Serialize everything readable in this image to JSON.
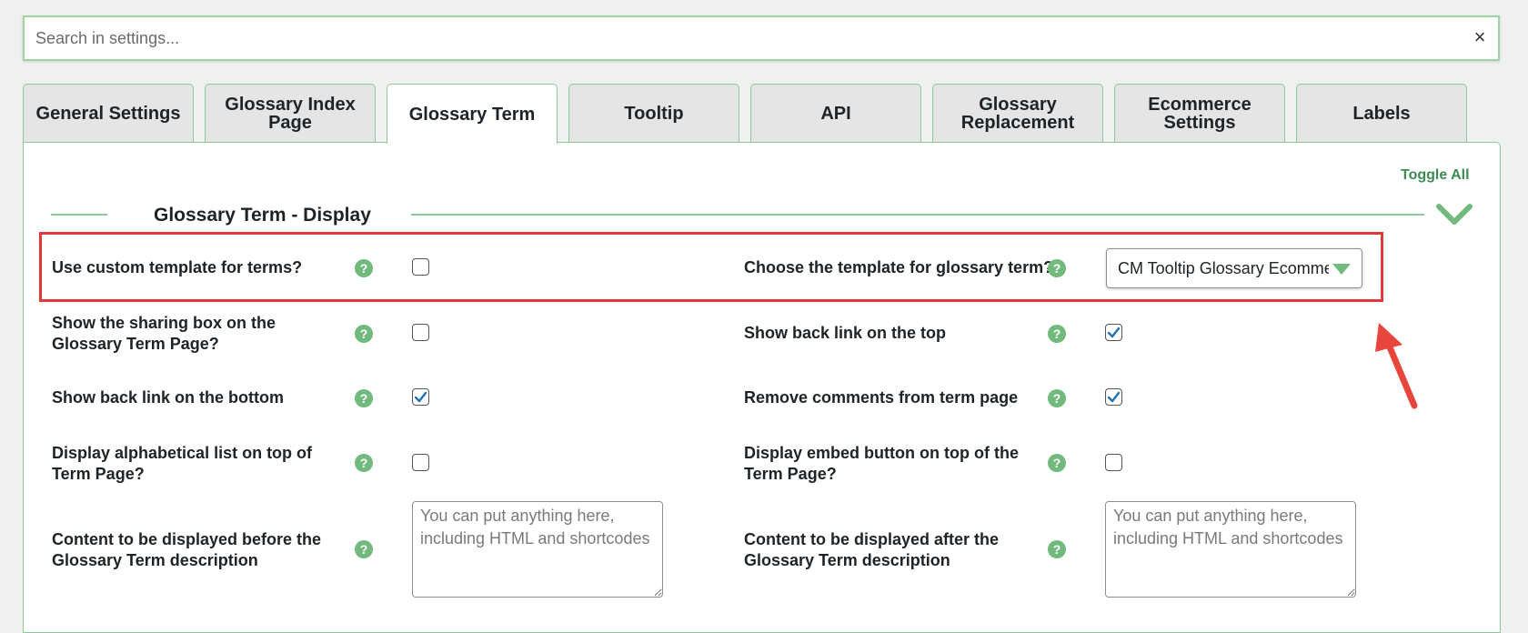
{
  "search": {
    "placeholder": "Search in settings...",
    "clear_glyph": "×"
  },
  "tabs": [
    {
      "label": "General Settings",
      "active": false
    },
    {
      "label": "Glossary Index Page",
      "active": false
    },
    {
      "label": "Glossary Term",
      "active": true
    },
    {
      "label": "Tooltip",
      "active": false
    },
    {
      "label": "API",
      "active": false
    },
    {
      "label": "Glossary Replacement",
      "active": false
    },
    {
      "label": "Ecommerce Settings",
      "active": false
    },
    {
      "label": "Labels",
      "active": false
    }
  ],
  "panel": {
    "toggle_all_label": "Toggle All",
    "section_title": "Glossary Term - Display",
    "section_icon": "chevron-down-icon"
  },
  "settings": {
    "custom_template": {
      "label": "Use custom template for terms?",
      "checked": false
    },
    "sharing_box": {
      "label": "Show the sharing box on the Glossary Term Page?",
      "checked": false
    },
    "back_link_bottom": {
      "label": "Show back link on the bottom",
      "checked": true
    },
    "alphabetical_list": {
      "label": "Display alphabetical list on top of Term Page?",
      "checked": false
    },
    "content_before": {
      "label": "Content to be displayed before the Glossary Term description",
      "placeholder": "You can put anything here, including HTML and shortcodes"
    },
    "choose_template": {
      "label": "Choose the template for glossary term?",
      "selected": "CM Tooltip Glossary Ecommerce"
    },
    "back_link_top": {
      "label": "Show back link on the top",
      "checked": true
    },
    "remove_comments": {
      "label": "Remove comments from term page",
      "checked": true
    },
    "embed_button": {
      "label": "Display embed button on top of the Term Page?",
      "checked": false
    },
    "content_after": {
      "label": "Content to be displayed after the Glossary Term description",
      "placeholder": "You can put anything here, including HTML and shortcodes"
    }
  },
  "help_glyph": "?",
  "colors": {
    "accent_green": "#71b97c",
    "border_green": "#8fc99a",
    "highlight_red": "#e0393b",
    "check_blue": "#2271b1"
  }
}
